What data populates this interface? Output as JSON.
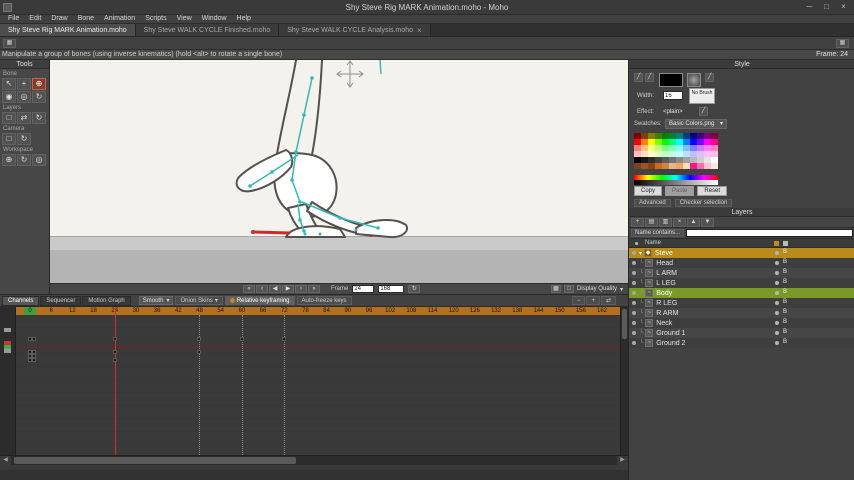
{
  "colors": {
    "selected_layer": "#b98a1c",
    "highlight_layer": "#7a9a28",
    "ruler": "#b4701c",
    "ruler_zero": "#3f9f3f",
    "playhead": "#d03030",
    "bone": "#35b8b8",
    "bone_selected": "#cc2b2b",
    "outline": "#55504c",
    "canvas_bg": "#f4f2ec"
  },
  "icons": {
    "close": "×",
    "minimize": "─",
    "maximize": "□",
    "dropdown": "▾",
    "grid": "▦",
    "pen": "╱",
    "loop": "↻"
  },
  "window": {
    "title": "Shy Steve Rig MARK Animation.moho - Moho",
    "controls": [
      "─",
      "□",
      "×"
    ]
  },
  "menu": {
    "items": [
      "File",
      "Edit",
      "Draw",
      "Bone",
      "Animation",
      "Scripts",
      "View",
      "Window",
      "Help"
    ]
  },
  "tabs": [
    {
      "label": "Shy Steve Rig MARK Animation.moho",
      "active": true,
      "closable": false
    },
    {
      "label": "Shy Steve WALK CYCLE Finished.moho",
      "active": false,
      "closable": false
    },
    {
      "label": "Shy Steve WALK CYCLE Analysis.moho",
      "active": false,
      "closable": true
    }
  ],
  "hint": {
    "text": "Manipulate a group of bones (using inverse kinematics) (hold <alt> to rotate a single bone)",
    "frame_label": "Frame: 24"
  },
  "tools": {
    "title": "Tools",
    "groups": [
      {
        "label": "Bone",
        "icons": [
          {
            "name": "select-bone-tool",
            "glyph": "↖"
          },
          {
            "name": "translate-bone-tool",
            "glyph": "+"
          },
          {
            "name": "manipulate-bones-tool",
            "glyph": "⊕",
            "selected": true
          },
          {
            "name": "add-bone-tool",
            "glyph": "◉"
          },
          {
            "name": "bone-strength-tool",
            "glyph": "◎"
          },
          {
            "name": "reparent-bone-tool",
            "glyph": "↻"
          }
        ]
      },
      {
        "label": "Layers",
        "icons": [
          {
            "name": "transform-layer-tool",
            "glyph": "□"
          },
          {
            "name": "shear-layer-tool",
            "glyph": "⇄"
          },
          {
            "name": "rotate-layer-tool",
            "glyph": "↻"
          }
        ]
      },
      {
        "label": "Camera",
        "icons": [
          {
            "name": "track-camera-tool",
            "glyph": "□"
          },
          {
            "name": "roll-camera-tool",
            "glyph": "↻"
          }
        ]
      },
      {
        "label": "Workspace",
        "icons": [
          {
            "name": "pan-workspace-tool",
            "glyph": "⊕"
          },
          {
            "name": "rotate-workspace-tool",
            "glyph": "↻"
          },
          {
            "name": "zoom-workspace-tool",
            "glyph": "◎"
          }
        ]
      }
    ]
  },
  "style_panel": {
    "title": "Style",
    "width_label": "Width:",
    "width_value": "16",
    "no_brush_label": "No Brush",
    "effect_label": "Effect:",
    "effect_value": "<plain>",
    "swatches_label": "Swatches:",
    "swatches_value": "Basic Colors.png",
    "palette_rows": [
      [
        "#7f0000",
        "#7f3f00",
        "#7f7f00",
        "#3f7f00",
        "#007f00",
        "#007f3f",
        "#007f7f",
        "#003f7f",
        "#00007f",
        "#3f007f",
        "#7f007f",
        "#7f003f"
      ],
      [
        "#ff0000",
        "#ff7f00",
        "#ffff00",
        "#7fff00",
        "#00ff00",
        "#00ff7f",
        "#00ffff",
        "#007fff",
        "#0000ff",
        "#7f00ff",
        "#ff00ff",
        "#ff007f"
      ],
      [
        "#ff7f7f",
        "#ffbf7f",
        "#ffff7f",
        "#bfff7f",
        "#7fff7f",
        "#7fffbf",
        "#7fffff",
        "#7fbfff",
        "#7f7fff",
        "#bf7fff",
        "#ff7fff",
        "#ff7fbf"
      ],
      [
        "#ffbfbf",
        "#ffdfbf",
        "#ffffbf",
        "#dfffbf",
        "#bfffbf",
        "#bfffdf",
        "#bfffff",
        "#bfdfff",
        "#bfbfff",
        "#dfbfff",
        "#ffbfff",
        "#ffbfdf"
      ],
      [
        "#000000",
        "#171717",
        "#2e2e2e",
        "#454545",
        "#5c5c5c",
        "#737373",
        "#8a8a8a",
        "#a1a1a1",
        "#b8b8b8",
        "#cfcfcf",
        "#e6e6e6",
        "#ffffff"
      ],
      [
        "#7f3f1f",
        "#a0522d",
        "#8b4513",
        "#d2691e",
        "#cd853f",
        "#deb887",
        "#f4a460",
        "#ffdead",
        "#ff1493",
        "#ff69b4",
        "#ffc0cb",
        "#ffe4e1"
      ]
    ],
    "copy_label": "Copy",
    "paste_label": "Paste",
    "reset_label": "Reset",
    "advanced_label": "Advanced",
    "checker_label": "Checker selection"
  },
  "layers_panel": {
    "title": "Layers",
    "toolbar_icons": [
      {
        "name": "new-layer-icon",
        "glyph": "+"
      },
      {
        "name": "new-folder-icon",
        "glyph": "▤"
      },
      {
        "name": "duplicate-layer-icon",
        "glyph": "▥"
      },
      {
        "name": "delete-layer-icon",
        "glyph": "×"
      },
      {
        "name": "move-layer-up-icon",
        "glyph": "▲"
      },
      {
        "name": "move-layer-down-icon",
        "glyph": "▼"
      }
    ],
    "filter_label": "Name contains...",
    "filter_value": "",
    "name_header": "Name",
    "badge": "B",
    "layers": [
      {
        "name": "Steve",
        "type": "bone",
        "selected": true,
        "indent": 0,
        "expanded": true
      },
      {
        "name": "Head",
        "type": "vector",
        "indent": 1
      },
      {
        "name": "L ARM",
        "type": "vector",
        "indent": 1
      },
      {
        "name": "L LEG",
        "type": "vector",
        "indent": 1
      },
      {
        "name": "Body",
        "type": "vector",
        "indent": 1,
        "highlight": true
      },
      {
        "name": "R LEG",
        "type": "vector",
        "indent": 1
      },
      {
        "name": "R ARM",
        "type": "vector",
        "indent": 1
      },
      {
        "name": "Neck",
        "type": "vector",
        "indent": 1
      },
      {
        "name": "Ground 1",
        "type": "vector",
        "indent": 1
      },
      {
        "name": "Ground 2",
        "type": "vector",
        "indent": 1
      }
    ]
  },
  "timeline": {
    "tabs": [
      "Channels",
      "Sequencer",
      "Motion Graph"
    ],
    "smooth_label": "Smooth",
    "onion_label": "Onion Skins",
    "relative_label": "Relative keyframing",
    "autofreeze_label": "Auto-freeze keys",
    "right_icons": [
      {
        "name": "zoom-out-timeline-icon",
        "glyph": "−"
      },
      {
        "name": "zoom-in-timeline-icon",
        "glyph": "+"
      },
      {
        "name": "fit-timeline-icon",
        "glyph": "⇄"
      }
    ],
    "ticks": [
      0,
      6,
      12,
      18,
      24,
      30,
      36,
      42,
      48,
      54,
      60,
      66,
      72,
      78,
      84,
      90,
      96,
      102,
      108,
      114,
      120,
      126,
      132,
      138,
      144,
      150,
      156,
      162
    ],
    "current_frame": 24,
    "marker_frames": [
      48,
      60,
      72
    ],
    "rows": [
      {
        "name": "bone-channel",
        "keys": [
          0,
          1,
          24,
          48,
          60,
          72
        ]
      },
      {
        "name": "transform-channel",
        "keys": [
          0,
          1,
          24,
          48
        ]
      },
      {
        "name": "point-channel",
        "keys": [
          0,
          1
        ]
      },
      {
        "name": "curve-channel",
        "keys": [
          0,
          1,
          24
        ]
      }
    ]
  },
  "playback": {
    "buttons": [
      {
        "name": "jump-start-button",
        "glyph": "«"
      },
      {
        "name": "prev-keyframe-button",
        "glyph": "‹"
      },
      {
        "name": "step-back-button",
        "glyph": "◀"
      },
      {
        "name": "play-button",
        "glyph": "▶"
      },
      {
        "name": "step-forward-button",
        "glyph": "›"
      },
      {
        "name": "jump-end-button",
        "glyph": "»"
      }
    ],
    "frame_label": "Frame",
    "frame_value": "24",
    "end_value": "168",
    "display_quality_label": "Display Quality"
  }
}
